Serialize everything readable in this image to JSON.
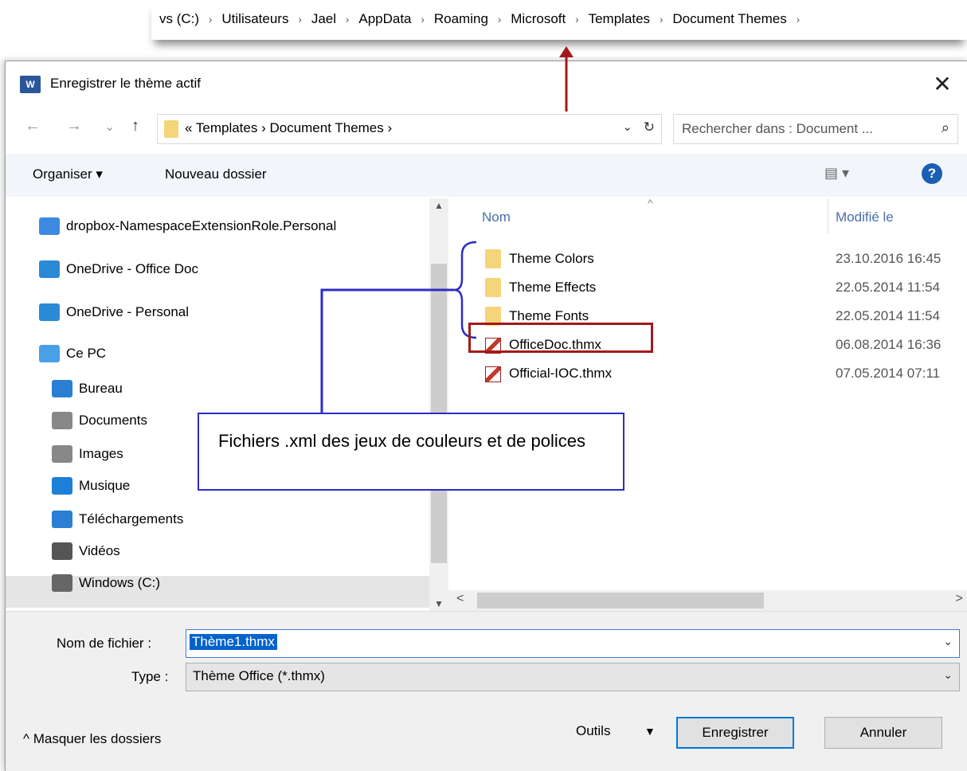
{
  "path_strip": {
    "crumbs": [
      "vs (C:)",
      "Utilisateurs",
      "Jael",
      "AppData",
      "Roaming",
      "Microsoft",
      "Templates",
      "Document Themes"
    ],
    "separator": "›"
  },
  "dialog": {
    "title": "Enregistrer le thème actif",
    "icon_text": "W",
    "close": "✕"
  },
  "nav": {
    "back": "←",
    "forward": "→",
    "recent": "⌄",
    "up": "↑",
    "address": "« Templates › Document Themes ›",
    "address_dropdown": "⌄",
    "refresh": "↻",
    "search_placeholder": "Rechercher dans : Document ...",
    "search_icon": "⌕"
  },
  "toolbar": {
    "organise": "Organiser ▾",
    "new_folder": "Nouveau dossier",
    "view": "▤ ▾",
    "help": "?"
  },
  "sidebar": {
    "items": [
      {
        "label": "dropbox-NamespaceExtensionRole.Personal",
        "icon": "dropbox-icon",
        "color": "#3d8ae0"
      },
      {
        "label": "OneDrive - Office Doc",
        "icon": "onedrive-icon",
        "color": "#2b8ad6"
      },
      {
        "label": "OneDrive - Personal",
        "icon": "onedrive-icon",
        "color": "#2b8ad6"
      },
      {
        "label": "Ce PC",
        "icon": "pc-icon",
        "color": "#4aa0e6"
      },
      {
        "label": "Bureau",
        "icon": "desktop-icon",
        "color": "#2a7fd4"
      },
      {
        "label": "Documents",
        "icon": "documents-icon",
        "color": "#888888"
      },
      {
        "label": "Images",
        "icon": "images-icon",
        "color": "#888888"
      },
      {
        "label": "Musique",
        "icon": "music-icon",
        "color": "#1c7fd8"
      },
      {
        "label": "Téléchargements",
        "icon": "download-icon",
        "color": "#2a7fd4"
      },
      {
        "label": "Vidéos",
        "icon": "video-icon",
        "color": "#555555"
      },
      {
        "label": "Windows (C:)",
        "icon": "drive-icon",
        "color": "#666666"
      }
    ]
  },
  "files": {
    "col_name": "Nom",
    "col_modified": "Modifié le",
    "sort_glyph": "^",
    "rows": [
      {
        "name": "Theme Colors",
        "date": "23.10.2016 16:45",
        "type": "folder"
      },
      {
        "name": "Theme Effects",
        "date": "22.05.2014 11:54",
        "type": "folder"
      },
      {
        "name": "Theme Fonts",
        "date": "22.05.2014 11:54",
        "type": "folder"
      },
      {
        "name": "OfficeDoc.thmx",
        "date": "06.08.2014 16:36",
        "type": "thmx"
      },
      {
        "name": "Official-IOC.thmx",
        "date": "07.05.2014 07:11",
        "type": "thmx"
      }
    ]
  },
  "bottom": {
    "filename_label": "Nom de fichier :",
    "filename_value": "Thème1.thmx",
    "type_label": "Type :",
    "type_value": "Thème Office (*.thmx)",
    "hide_folders": "^  Masquer les dossiers",
    "tools": "Outils",
    "save": "Enregistrer",
    "cancel": "Annuler"
  },
  "annotation": {
    "text": "Fichiers .xml des jeux de couleurs et de polices",
    "box_color": "#2c2cc8",
    "highlight_color": "#a31919"
  }
}
